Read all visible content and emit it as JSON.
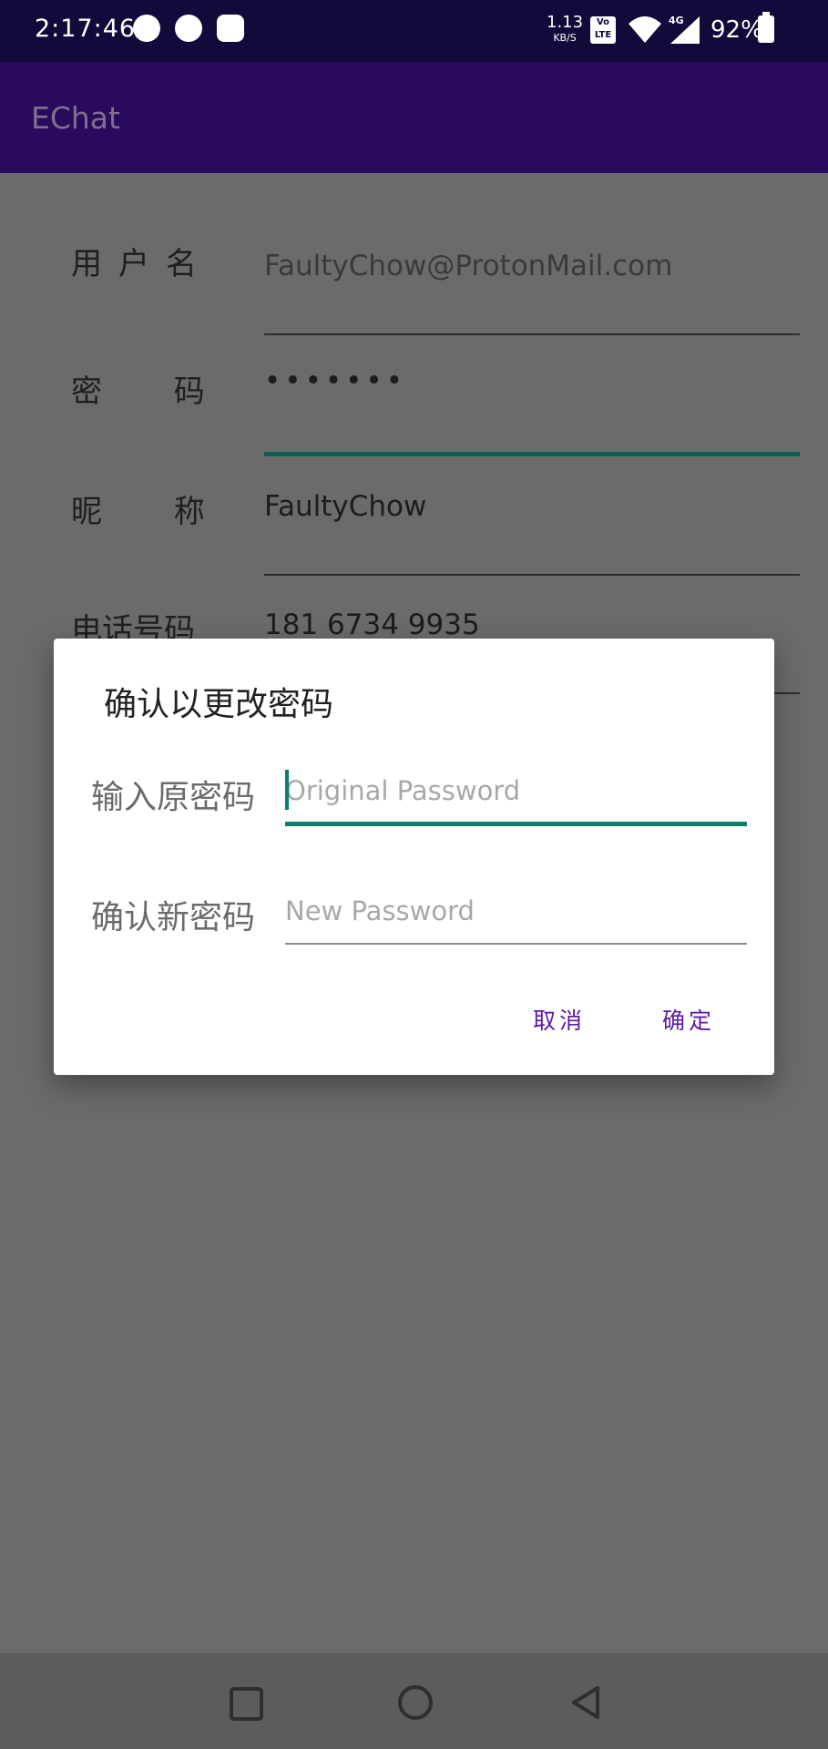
{
  "status_bar": {
    "time": "2:17:46",
    "net_speed": "1.13",
    "net_unit": "KB/S",
    "volte": "Vo LTE",
    "network": "4G",
    "battery": "92%",
    "notification_icons": [
      "chat-bubble-icon",
      "mask-icon",
      "badge-icon"
    ]
  },
  "app_bar": {
    "title": "EChat"
  },
  "profile": {
    "username_label": "用户名",
    "username_value": "FaultyChow@ProtonMail.com",
    "password_label": "密 码",
    "password_value": "•••••••",
    "nickname_label": "昵 称",
    "nickname_value": "FaultyChow",
    "phone_label": "电话号码",
    "phone_value": "181 6734 9935"
  },
  "dialog": {
    "title": "确认以更改密码",
    "original_label": "输入原密码",
    "original_placeholder": "Original Password",
    "new_label": "确认新密码",
    "new_placeholder": "New Password",
    "cancel": "取消",
    "confirm": "确定"
  },
  "colors": {
    "app_bar": "#2a0a5c",
    "accent": "#0c7d6d",
    "dialog_button": "#5b1aa6"
  }
}
